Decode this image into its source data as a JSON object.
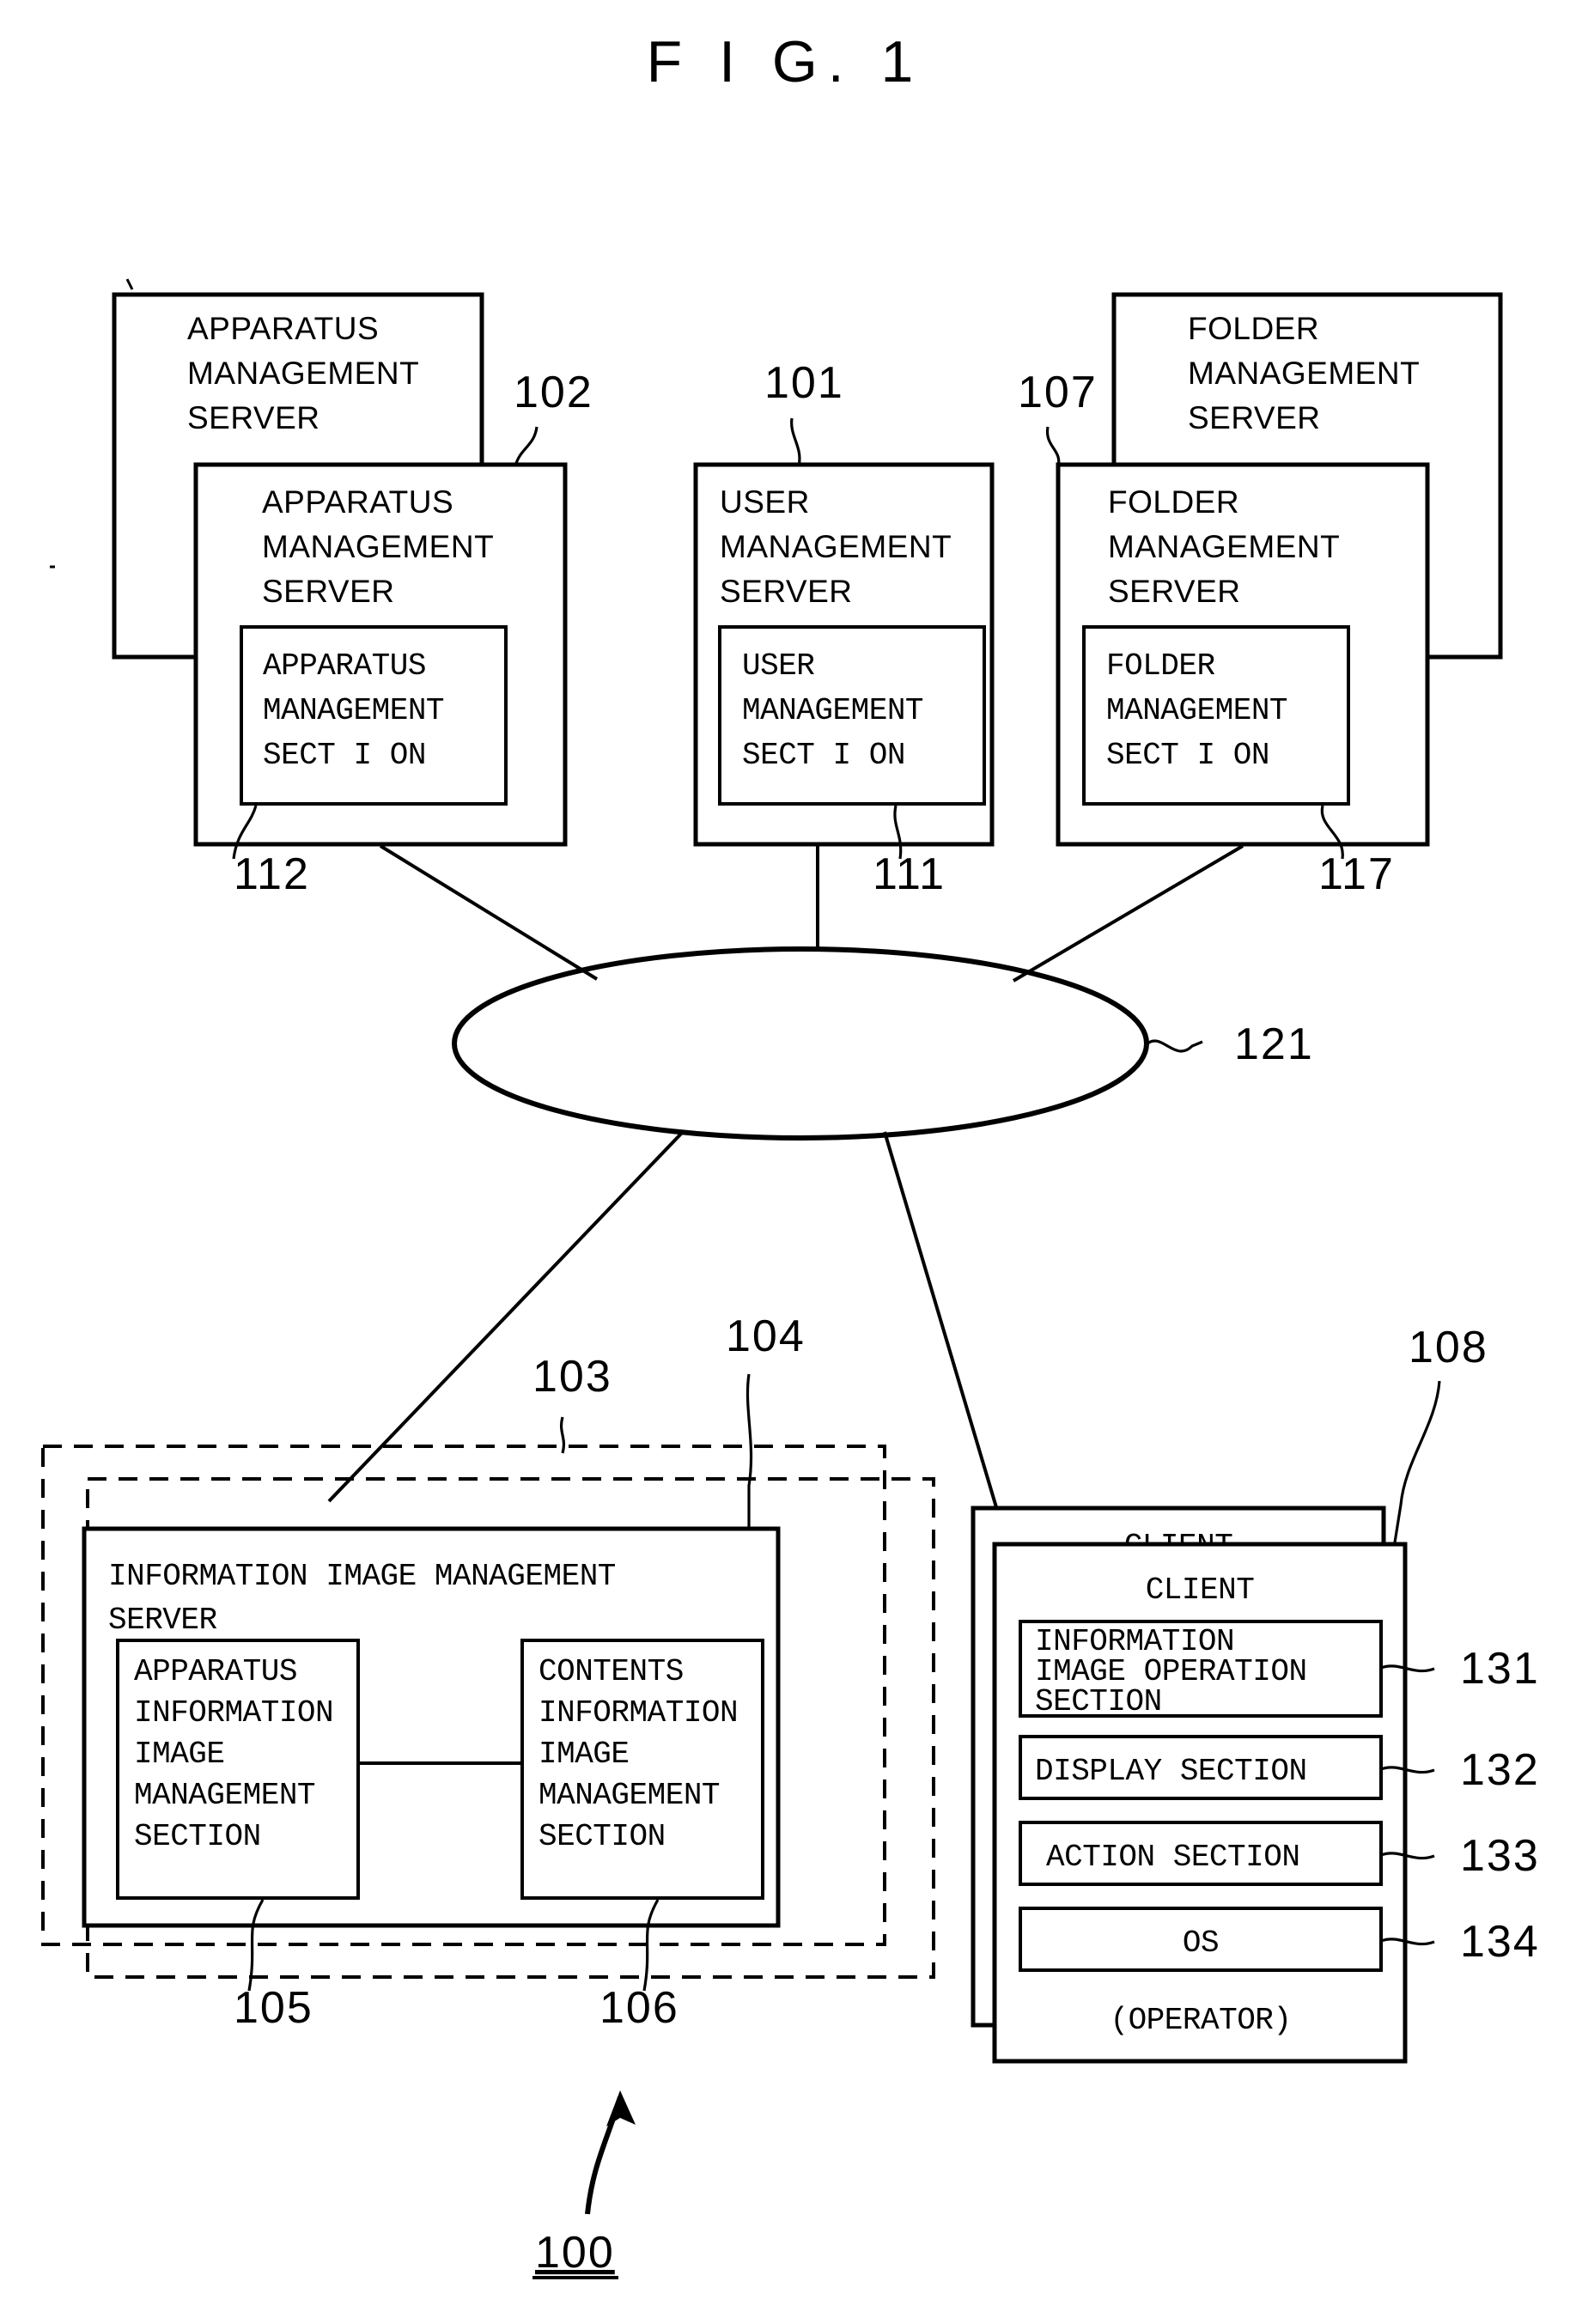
{
  "figure": {
    "title": "F I G. 1",
    "system_ref": "100"
  },
  "nodes": {
    "apparatus_server_back": {
      "ref": "",
      "lines": [
        "APPARATUS",
        "MANAGEMENT",
        "SERVER"
      ]
    },
    "apparatus_server_front": {
      "ref": "102",
      "lines": [
        "APPARATUS",
        "MANAGEMENT",
        "SERVER"
      ],
      "inner": {
        "ref": "112",
        "lines": [
          "APPARATUS",
          "MANAGEMENT",
          "SECT I ON"
        ]
      }
    },
    "user_server": {
      "ref": "101",
      "lines": [
        "USER",
        "MANAGEMENT",
        "SERVER"
      ],
      "inner": {
        "ref": "111",
        "lines": [
          "USER",
          "MANAGEMENT",
          "SECT I ON"
        ]
      }
    },
    "folder_server_back": {
      "ref": "",
      "lines": [
        "FOLDER",
        "MANAGEMENT",
        "SERVER"
      ]
    },
    "folder_server_front": {
      "ref": "107",
      "lines": [
        "FOLDER",
        "MANAGEMENT",
        "SERVER"
      ],
      "inner": {
        "ref": "117",
        "lines": [
          "FOLDER",
          "MANAGEMENT",
          "SECT I ON"
        ]
      }
    },
    "network": {
      "ref": "121",
      "label": ""
    },
    "info_image_server": {
      "ref_outer": "103",
      "ref_inner": "104",
      "lines": [
        "INFORMATION  IMAGE MANAGEMENT",
        "SERVER"
      ],
      "apparatus_section": {
        "ref": "105",
        "lines": [
          "APPARATUS",
          "INFORMATION",
          "IMAGE",
          "MANAGEMENT",
          "SECTION"
        ]
      },
      "contents_section": {
        "ref": "106",
        "lines": [
          "CONTENTS",
          "INFORMATION",
          "IMAGE",
          "MANAGEMENT",
          "SECTION"
        ]
      }
    },
    "client_back": {
      "ref": "",
      "title": "CLIENT"
    },
    "client_front": {
      "ref": "108",
      "title": "CLIENT",
      "footer": "(OPERATOR)",
      "modules": [
        {
          "ref": "131",
          "lines": [
            "INFORMATION",
            "IMAGE OPERATION",
            "SECTION"
          ]
        },
        {
          "ref": "132",
          "lines": [
            "DISPLAY SECTION"
          ]
        },
        {
          "ref": "133",
          "lines": [
            "ACTION SECTION"
          ]
        },
        {
          "ref": "134",
          "lines": [
            "OS"
          ]
        }
      ]
    }
  },
  "colors": {
    "ink": "#000000",
    "paper": "#ffffff"
  }
}
